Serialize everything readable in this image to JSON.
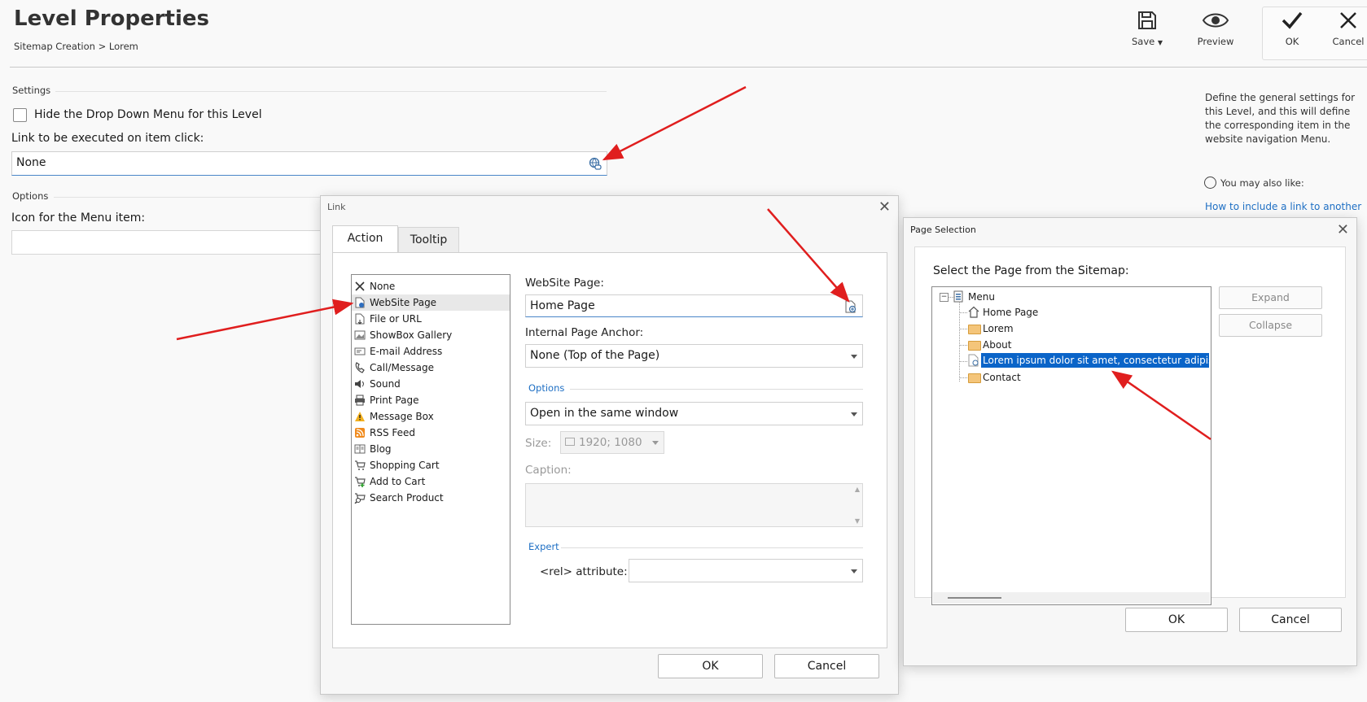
{
  "header": {
    "title": "Level Properties",
    "breadcrumb": "Sitemap Creation > Lorem",
    "toolbar": {
      "save_label": "Save",
      "preview_label": "Preview",
      "ok_label": "OK",
      "cancel_label": "Cancel"
    }
  },
  "settings": {
    "section_label": "Settings",
    "hide_dropdown_label": "Hide the Drop Down Menu for this Level",
    "hide_dropdown_checked": false,
    "link_label": "Link to be executed on item click:",
    "link_value": "None"
  },
  "options": {
    "section_label": "Options",
    "icon_label": "Icon for the Menu item:",
    "icon_value": ""
  },
  "sidebar": {
    "description": "Define the general settings for this Level, and this will define the corresponding item in the website navigation Menu.",
    "you_may_like": "You may also like:",
    "link_text": "How to include a link to another"
  },
  "link_dialog": {
    "title": "Link",
    "tabs": [
      "Action",
      "Tooltip"
    ],
    "active_tab": "Action",
    "actions": [
      {
        "label": "None",
        "icon": "x-icon"
      },
      {
        "label": "WebSite Page",
        "icon": "page-icon"
      },
      {
        "label": "File or URL",
        "icon": "file-icon"
      },
      {
        "label": "ShowBox Gallery",
        "icon": "gallery-icon"
      },
      {
        "label": "E-mail Address",
        "icon": "email-icon"
      },
      {
        "label": "Call/Message",
        "icon": "phone-icon"
      },
      {
        "label": "Sound",
        "icon": "sound-icon"
      },
      {
        "label": "Print Page",
        "icon": "printer-icon"
      },
      {
        "label": "Message Box",
        "icon": "warning-icon"
      },
      {
        "label": "RSS Feed",
        "icon": "rss-icon"
      },
      {
        "label": "Blog",
        "icon": "blog-icon"
      },
      {
        "label": "Shopping Cart",
        "icon": "cart-icon"
      },
      {
        "label": "Add to Cart",
        "icon": "add-cart-icon"
      },
      {
        "label": "Search Product",
        "icon": "search-cart-icon"
      }
    ],
    "selected_action": "WebSite Page",
    "website_page_label": "WebSite Page:",
    "website_page_value": "Home Page",
    "anchor_label": "Internal Page Anchor:",
    "anchor_value": "None (Top of the Page)",
    "options_group": "Options",
    "window_value": "Open in the same window",
    "size_label": "Size:",
    "size_value": "1920; 1080",
    "caption_label": "Caption:",
    "expert_group": "Expert",
    "rel_label": "<rel> attribute:",
    "rel_value": "",
    "ok_label": "OK",
    "cancel_label": "Cancel"
  },
  "page_dialog": {
    "title": "Page Selection",
    "prompt": "Select the Page from the Sitemap:",
    "tree_root": "Menu",
    "tree_items": [
      "Home Page",
      "Lorem",
      "About",
      "Lorem ipsum dolor sit amet, consectetur adipisc",
      "Contact"
    ],
    "selected_item": "Lorem ipsum dolor sit amet, consectetur adipisc",
    "expand_label": "Expand",
    "collapse_label": "Collapse",
    "ok_label": "OK",
    "cancel_label": "Cancel"
  },
  "colors": {
    "accent": "#1e6fc4",
    "selection": "#0a64c8",
    "annotation_arrow": "#e01e1e"
  }
}
